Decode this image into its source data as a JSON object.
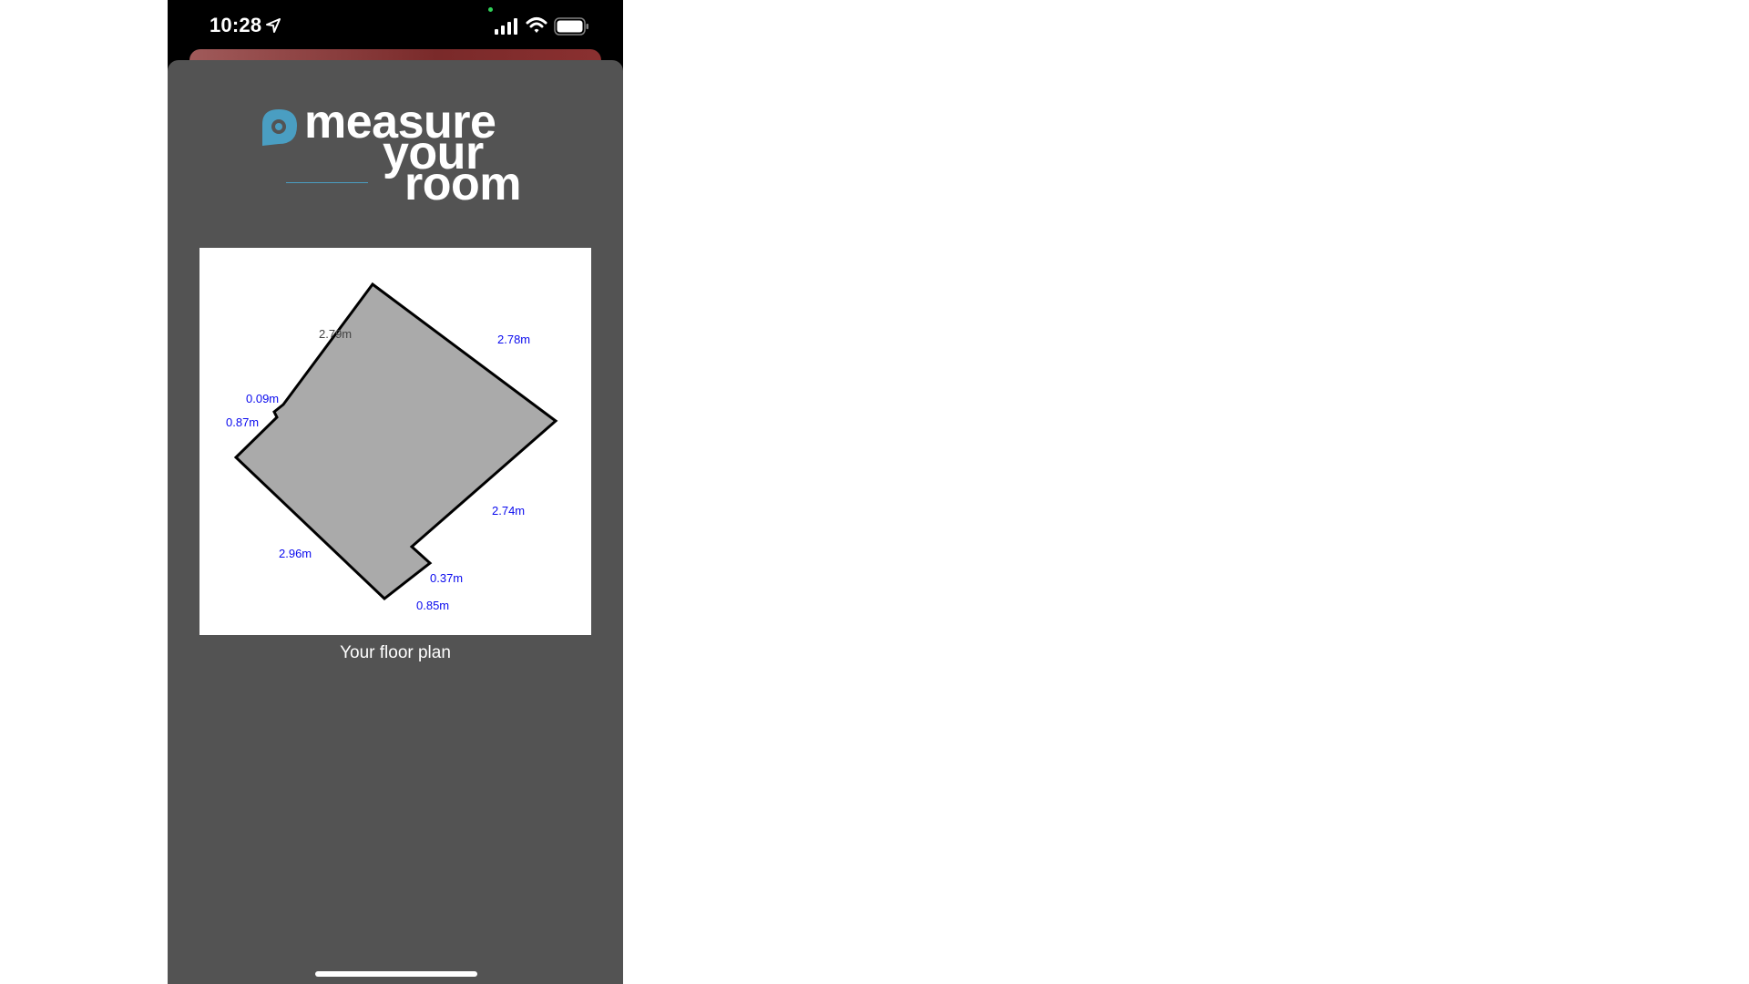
{
  "status_bar": {
    "time": "10:28",
    "icons": [
      "location-arrow-icon",
      "signal-bars-icon",
      "wifi-icon",
      "battery-icon"
    ]
  },
  "logo": {
    "word1": "measure",
    "word2": "your",
    "word3": "room",
    "icon": "tape-measure-icon"
  },
  "floor_plan": {
    "caption": "Your floor plan",
    "dimensions": {
      "top_left": "2.79m",
      "top_right": "2.78m",
      "left_short": "0.09m",
      "left": "0.87m",
      "bottom_left": "2.96m",
      "right": "2.74m",
      "notch": "0.37m",
      "bottom": "0.85m"
    }
  },
  "colors": {
    "sheet_background": "#535353",
    "room_fill": "#aaaaaa",
    "dimension_text": "#0a0aee",
    "logo_accent": "#4a9ec2"
  }
}
